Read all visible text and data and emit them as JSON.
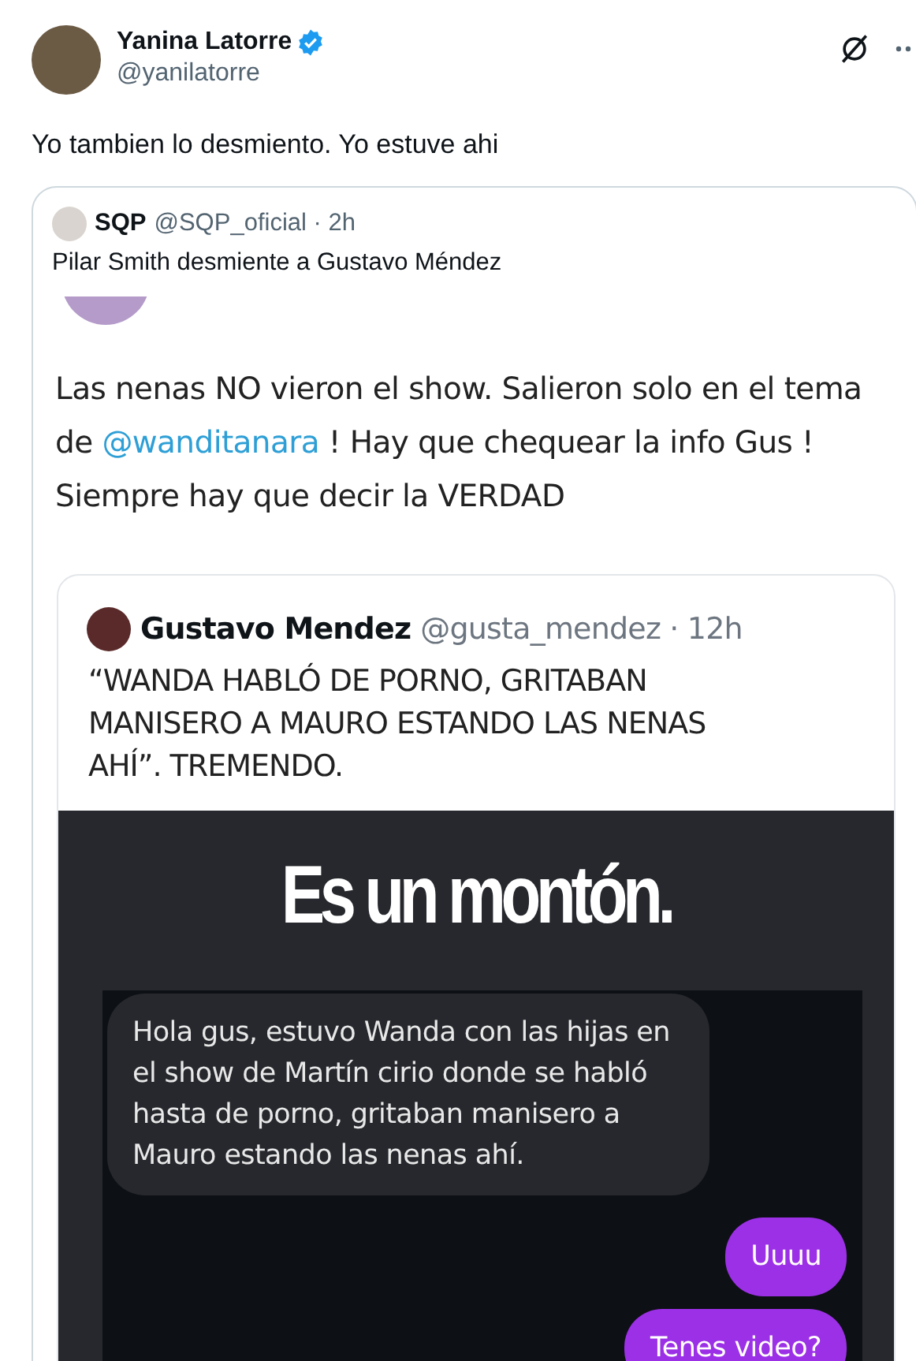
{
  "post": {
    "author": {
      "name": "Yanina Latorre",
      "verified": true,
      "handle": "@yanilatorre"
    },
    "text": "Yo tambien lo desmiento. Yo estuve ahi",
    "quote": {
      "author": {
        "name": "SQP",
        "meta": "@SQP_oficial · 2h"
      },
      "text": "Pilar Smith desmiente a Gustavo Méndez",
      "screenshot": {
        "segments": [
          {
            "kind": "plain",
            "text": "Las nenas NO vieron el show. Salieron solo en el tema de "
          },
          {
            "kind": "mention",
            "text": "@wanditanara"
          },
          {
            "kind": "plain",
            "text": " ! Hay que chequear la info Gus ! Siempre hay que decir la VERDAD"
          }
        ],
        "quote": {
          "author": {
            "name": "Gustavo Mendez",
            "meta": "@gusta_mendez · 12h"
          },
          "text": "“WANDA HABLÓ DE PORNO, GRITABAN MANISERO A MAURO ESTANDO LAS NENAS AHÍ”. TREMENDO.",
          "image": {
            "headline": "Es un montón.",
            "messages": [
              {
                "kind": "received",
                "text": "Hola gus, estuvo Wanda con las hijas en el show de Martín cirio donde se habló hasta de porno, gritaban manisero a Mauro estando las nenas ahí."
              },
              {
                "kind": "sent",
                "text": "Uuuu"
              },
              {
                "kind": "sent",
                "text": "Tenes video?"
              }
            ]
          }
        }
      }
    }
  }
}
